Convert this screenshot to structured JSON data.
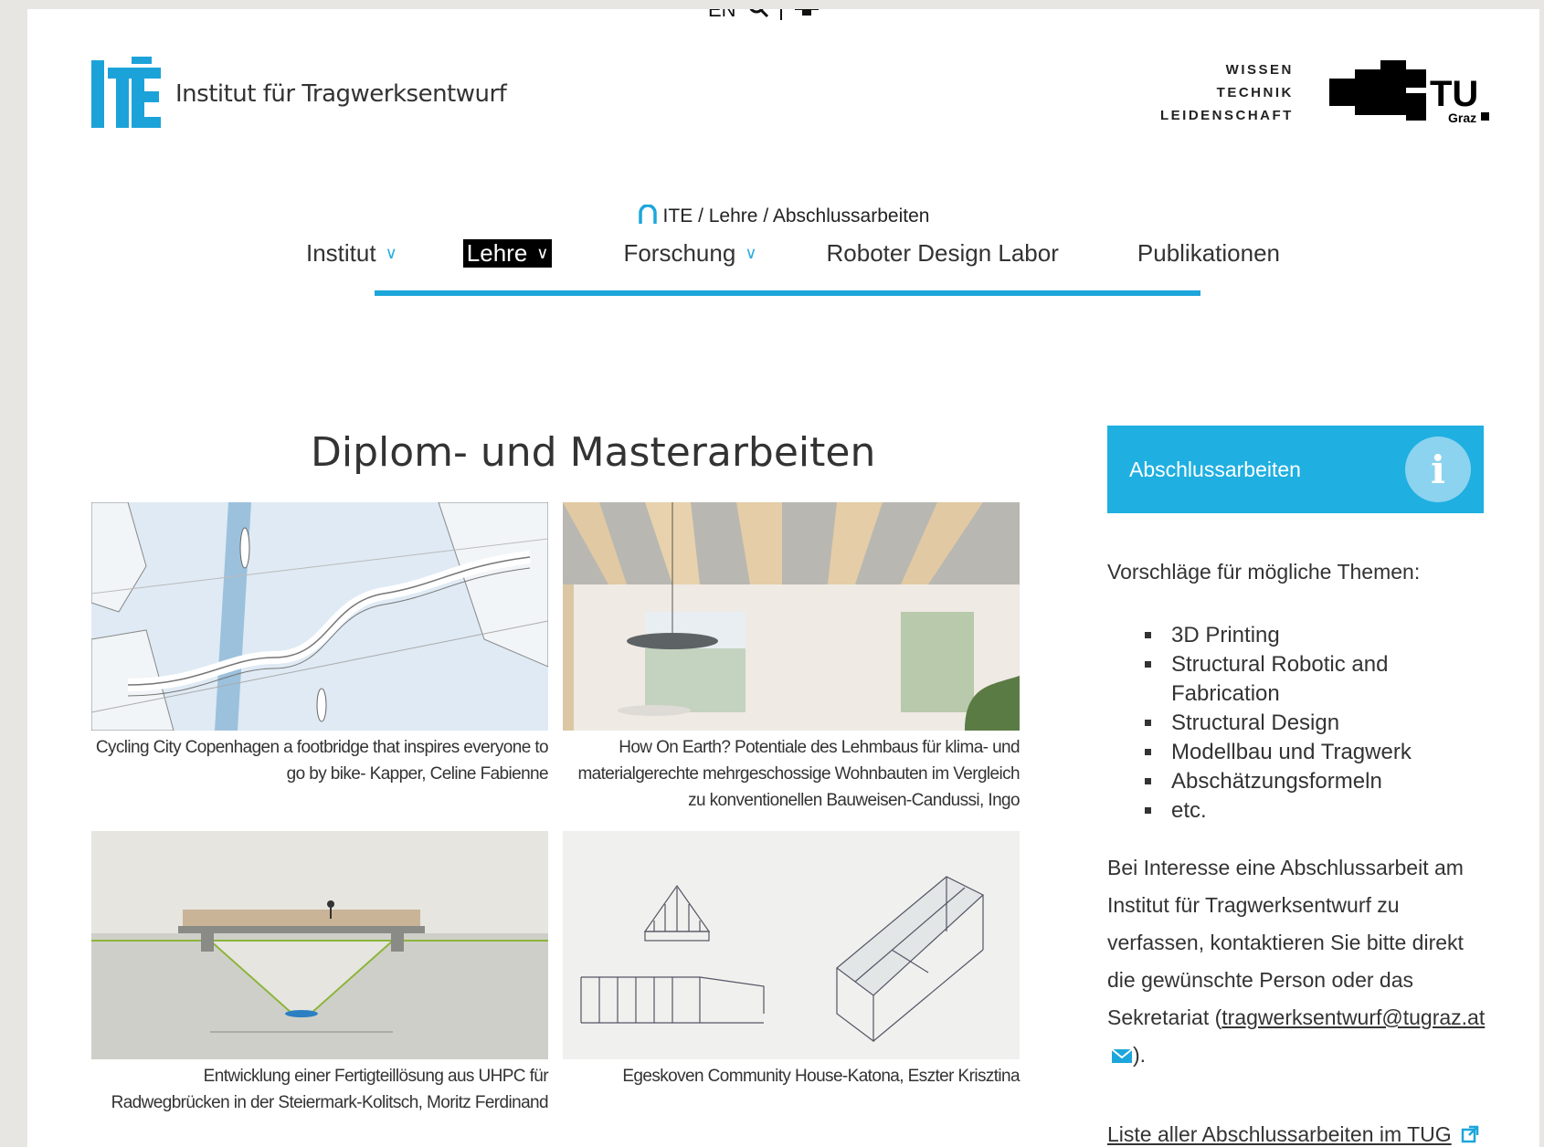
{
  "utility": {
    "lang": "EN"
  },
  "header": {
    "logo_text": "Institut für Tragwerksentwurf",
    "motto": [
      "WISSEN",
      "TECHNIK",
      "LEIDENSCHAFT"
    ],
    "tug_label": "TU",
    "tug_sub": "Graz"
  },
  "breadcrumb": {
    "items": [
      "ITE",
      "Lehre",
      "Abschlussarbeiten"
    ],
    "separator": "/"
  },
  "nav": {
    "items": [
      {
        "label": "Institut",
        "dropdown": true
      },
      {
        "label": "Lehre",
        "dropdown": true,
        "active": true
      },
      {
        "label": "Forschung",
        "dropdown": true
      },
      {
        "label": "Roboter Design Labor",
        "dropdown": false
      },
      {
        "label": "Publikationen",
        "dropdown": false
      }
    ]
  },
  "main": {
    "title": "Diplom- und Masterarbeiten",
    "projects": [
      {
        "caption": "Cycling City Copenhagen a footbridge that inspires everyone to go by bike- Kapper, Celine Fabienne"
      },
      {
        "caption": "How On Earth? Potentiale des Lehmbaus für klima- und materialgerechte mehrgeschossige Wohnbauten im Vergleich zu konventionellen Bauweisen-Candussi, Ingo"
      },
      {
        "caption": "Entwicklung einer Fertigteillösung aus UHPC für Radwegbrücken in der Steiermark-Kolitsch, Moritz Ferdinand"
      },
      {
        "caption": "Egeskoven Community House-Katona, Eszter Krisztina"
      }
    ]
  },
  "sidebar": {
    "header": "Abschlussarbeiten",
    "intro": "Vorschläge für mögliche Themen:",
    "topics": [
      "3D Printing",
      "Structural Robotic and Fabrication",
      "Structural Design",
      "Modellbau und Tragwerk",
      "Abschätzungsformeln",
      "etc."
    ],
    "contact_text": "Bei Interesse eine Abschlussarbeit am Institut für Tragwerksentwurf zu verfassen, kontaktieren Sie bitte direkt die gewünschte Person oder das Sekretariat",
    "email": "tragwerksentwurf@tugraz.at",
    "list_link": "Liste aller Abschlussarbeiten im TUG"
  },
  "colors": {
    "accent": "#1da6db",
    "sidebar_head": "#1fafe0"
  }
}
